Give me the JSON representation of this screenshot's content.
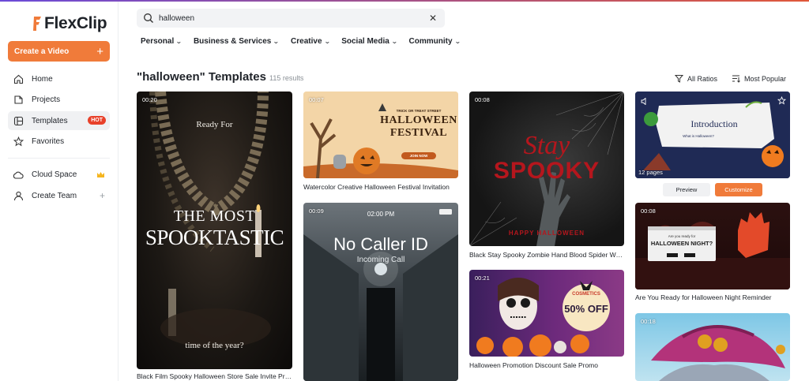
{
  "app": {
    "logo_text": "FlexClip"
  },
  "sidebar": {
    "create_label": "Create a Video",
    "items": [
      {
        "label": "Home"
      },
      {
        "label": "Projects"
      },
      {
        "label": "Templates",
        "badge": "HOT"
      },
      {
        "label": "Favorites"
      }
    ],
    "lower_items": [
      {
        "label": "Cloud Space"
      },
      {
        "label": "Create Team"
      }
    ]
  },
  "search": {
    "value": "halloween"
  },
  "categories": [
    {
      "label": "Personal"
    },
    {
      "label": "Business & Services"
    },
    {
      "label": "Creative"
    },
    {
      "label": "Social Media"
    },
    {
      "label": "Community"
    }
  ],
  "results": {
    "heading": "\"halloween\"  Templates",
    "count": "115 results",
    "filter_ratio": "All Ratios",
    "filter_sort": "Most Popular"
  },
  "cards": {
    "c1": {
      "duration": "00:20",
      "title": "Black Film Spooky Halloween Store Sale Invite Pro...",
      "line1": "Ready For",
      "line2": "THE MOST",
      "line3": "SPOOKTASTIC",
      "line4": "time of the year?"
    },
    "c2": {
      "duration": "00:07",
      "title": "Watercolor Creative Halloween Festival Invitation",
      "small": "TRICK OR TREAT STREET",
      "big1": "HALLOWEEN",
      "big2": "FESTIVAL",
      "cta": "JOIN NOW"
    },
    "c3": {
      "duration": "00:09",
      "clock": "02:00 PM",
      "caller": "No Caller ID",
      "sub": "Incoming Call"
    },
    "c4": {
      "duration": "00:08",
      "title": "Black Stay Spooky Zombie Hand Blood Spider Web...",
      "big1": "Stay",
      "big2": "SPOOKY",
      "small": "HAPPY HALLOWEEN"
    },
    "c5": {
      "duration": "00:21",
      "title": "Halloween Promotion Discount Sale Promo",
      "brand": "COSMETICS",
      "offer": "50% OFF"
    },
    "c6": {
      "pages": "12 pages",
      "intro": "Introduction",
      "sub": "What is Halloween?",
      "preview": "Preview",
      "customize": "Customize"
    },
    "c7": {
      "duration": "00:08",
      "title": "Are You Ready for Halloween Night Reminder",
      "q1": "Are you ready for",
      "q2": "HALLOWEEN NIGHT?"
    },
    "c8": {
      "duration": "00:18"
    }
  },
  "colors": {
    "accent": "#f07b3a",
    "hot": "#e8412a"
  }
}
